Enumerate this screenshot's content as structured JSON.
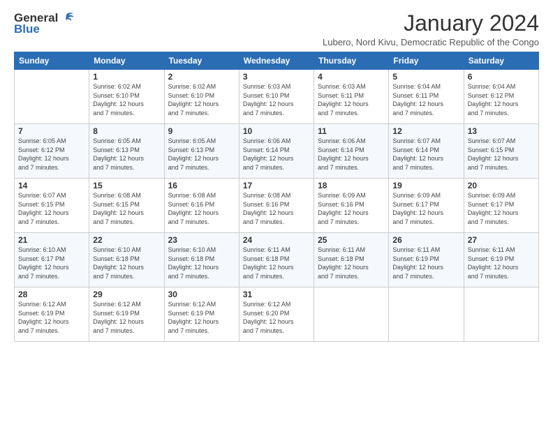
{
  "logo": {
    "line1": "General",
    "line2": "Blue"
  },
  "title": "January 2024",
  "location": "Lubero, Nord Kivu, Democratic Republic of the Congo",
  "days_of_week": [
    "Sunday",
    "Monday",
    "Tuesday",
    "Wednesday",
    "Thursday",
    "Friday",
    "Saturday"
  ],
  "weeks": [
    [
      {
        "day": "",
        "info": ""
      },
      {
        "day": "1",
        "info": "Sunrise: 6:02 AM\nSunset: 6:10 PM\nDaylight: 12 hours\nand 7 minutes."
      },
      {
        "day": "2",
        "info": "Sunrise: 6:02 AM\nSunset: 6:10 PM\nDaylight: 12 hours\nand 7 minutes."
      },
      {
        "day": "3",
        "info": "Sunrise: 6:03 AM\nSunset: 6:10 PM\nDaylight: 12 hours\nand 7 minutes."
      },
      {
        "day": "4",
        "info": "Sunrise: 6:03 AM\nSunset: 6:11 PM\nDaylight: 12 hours\nand 7 minutes."
      },
      {
        "day": "5",
        "info": "Sunrise: 6:04 AM\nSunset: 6:11 PM\nDaylight: 12 hours\nand 7 minutes."
      },
      {
        "day": "6",
        "info": "Sunrise: 6:04 AM\nSunset: 6:12 PM\nDaylight: 12 hours\nand 7 minutes."
      }
    ],
    [
      {
        "day": "7",
        "info": "Sunrise: 6:05 AM\nSunset: 6:12 PM\nDaylight: 12 hours\nand 7 minutes."
      },
      {
        "day": "8",
        "info": "Sunrise: 6:05 AM\nSunset: 6:13 PM\nDaylight: 12 hours\nand 7 minutes."
      },
      {
        "day": "9",
        "info": "Sunrise: 6:05 AM\nSunset: 6:13 PM\nDaylight: 12 hours\nand 7 minutes."
      },
      {
        "day": "10",
        "info": "Sunrise: 6:06 AM\nSunset: 6:14 PM\nDaylight: 12 hours\nand 7 minutes."
      },
      {
        "day": "11",
        "info": "Sunrise: 6:06 AM\nSunset: 6:14 PM\nDaylight: 12 hours\nand 7 minutes."
      },
      {
        "day": "12",
        "info": "Sunrise: 6:07 AM\nSunset: 6:14 PM\nDaylight: 12 hours\nand 7 minutes."
      },
      {
        "day": "13",
        "info": "Sunrise: 6:07 AM\nSunset: 6:15 PM\nDaylight: 12 hours\nand 7 minutes."
      }
    ],
    [
      {
        "day": "14",
        "info": "Sunrise: 6:07 AM\nSunset: 6:15 PM\nDaylight: 12 hours\nand 7 minutes."
      },
      {
        "day": "15",
        "info": "Sunrise: 6:08 AM\nSunset: 6:15 PM\nDaylight: 12 hours\nand 7 minutes."
      },
      {
        "day": "16",
        "info": "Sunrise: 6:08 AM\nSunset: 6:16 PM\nDaylight: 12 hours\nand 7 minutes."
      },
      {
        "day": "17",
        "info": "Sunrise: 6:08 AM\nSunset: 6:16 PM\nDaylight: 12 hours\nand 7 minutes."
      },
      {
        "day": "18",
        "info": "Sunrise: 6:09 AM\nSunset: 6:16 PM\nDaylight: 12 hours\nand 7 minutes."
      },
      {
        "day": "19",
        "info": "Sunrise: 6:09 AM\nSunset: 6:17 PM\nDaylight: 12 hours\nand 7 minutes."
      },
      {
        "day": "20",
        "info": "Sunrise: 6:09 AM\nSunset: 6:17 PM\nDaylight: 12 hours\nand 7 minutes."
      }
    ],
    [
      {
        "day": "21",
        "info": "Sunrise: 6:10 AM\nSunset: 6:17 PM\nDaylight: 12 hours\nand 7 minutes."
      },
      {
        "day": "22",
        "info": "Sunrise: 6:10 AM\nSunset: 6:18 PM\nDaylight: 12 hours\nand 7 minutes."
      },
      {
        "day": "23",
        "info": "Sunrise: 6:10 AM\nSunset: 6:18 PM\nDaylight: 12 hours\nand 7 minutes."
      },
      {
        "day": "24",
        "info": "Sunrise: 6:11 AM\nSunset: 6:18 PM\nDaylight: 12 hours\nand 7 minutes."
      },
      {
        "day": "25",
        "info": "Sunrise: 6:11 AM\nSunset: 6:18 PM\nDaylight: 12 hours\nand 7 minutes."
      },
      {
        "day": "26",
        "info": "Sunrise: 6:11 AM\nSunset: 6:19 PM\nDaylight: 12 hours\nand 7 minutes."
      },
      {
        "day": "27",
        "info": "Sunrise: 6:11 AM\nSunset: 6:19 PM\nDaylight: 12 hours\nand 7 minutes."
      }
    ],
    [
      {
        "day": "28",
        "info": "Sunrise: 6:12 AM\nSunset: 6:19 PM\nDaylight: 12 hours\nand 7 minutes."
      },
      {
        "day": "29",
        "info": "Sunrise: 6:12 AM\nSunset: 6:19 PM\nDaylight: 12 hours\nand 7 minutes."
      },
      {
        "day": "30",
        "info": "Sunrise: 6:12 AM\nSunset: 6:19 PM\nDaylight: 12 hours\nand 7 minutes."
      },
      {
        "day": "31",
        "info": "Sunrise: 6:12 AM\nSunset: 6:20 PM\nDaylight: 12 hours\nand 7 minutes."
      },
      {
        "day": "",
        "info": ""
      },
      {
        "day": "",
        "info": ""
      },
      {
        "day": "",
        "info": ""
      }
    ]
  ]
}
